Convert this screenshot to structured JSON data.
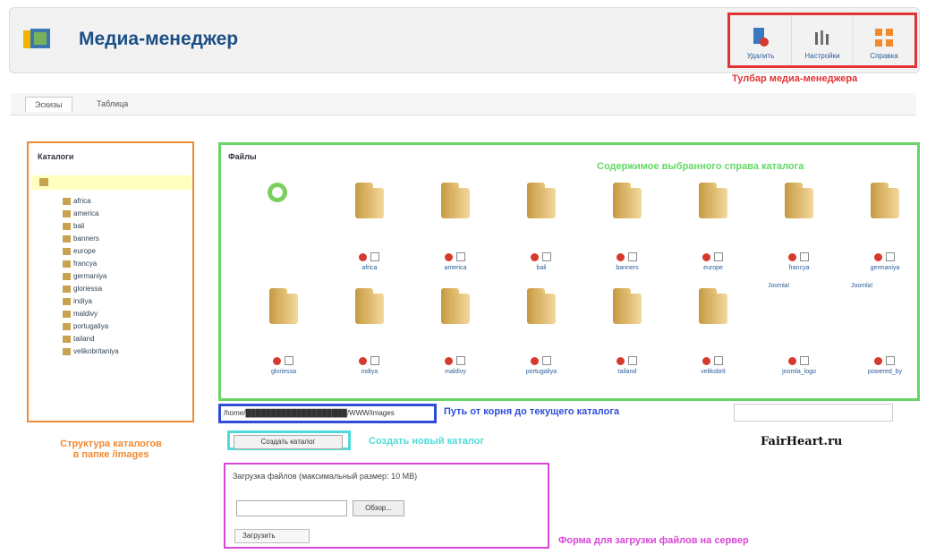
{
  "header": {
    "title": "Медиа-менеджер",
    "toolbar": {
      "buttons": [
        "Удалить",
        "Настройки",
        "Справка"
      ],
      "note": "Тулбар медиа-менеджера"
    }
  },
  "tabs": [
    "Эскизы",
    "Таблица"
  ],
  "catalog": {
    "title": "Каталоги",
    "items": [
      "africa",
      "america",
      "bali",
      "banners",
      "europe",
      "francya",
      "germaniya",
      "gloriessa",
      "indiya",
      "maldivy",
      "portugaliya",
      "tailand",
      "velikobritaniya"
    ],
    "note": "Структура каталогов\nв папке /images"
  },
  "files": {
    "title": "Файлы",
    "note": "Содержимое выбранного справа каталога",
    "row1": [
      "africa",
      "america",
      "bali",
      "banners",
      "europe",
      "francya",
      "germaniya"
    ],
    "row2": [
      "gloriessa",
      "indiya",
      "maldivy",
      "portugaliya",
      "tailand",
      "velikobrit",
      "joomla_logo",
      "powered_by"
    ],
    "row1_extra": [
      "Joomla!",
      "Joomla!"
    ]
  },
  "path": {
    "value": "/home/████████████████████/WWW/images",
    "note": "Путь от корня до текущего каталога"
  },
  "create": {
    "button": "Создать каталог",
    "note": "Создать новый каталог"
  },
  "brand": "FairHeart.ru",
  "upload": {
    "title": "Загрузка файлов (максимальный размер: 10 MB)",
    "browse": "Обзор...",
    "submit": "Загрузить",
    "note": "Форма для загрузки файлов на сервер"
  },
  "colors": {
    "toolbar_note": "#e23434",
    "catalog_border": "#f08a35",
    "files_border": "#68d468",
    "path_border": "#2e4ed8",
    "create_border": "#50dada",
    "upload_border": "#d847d8"
  }
}
